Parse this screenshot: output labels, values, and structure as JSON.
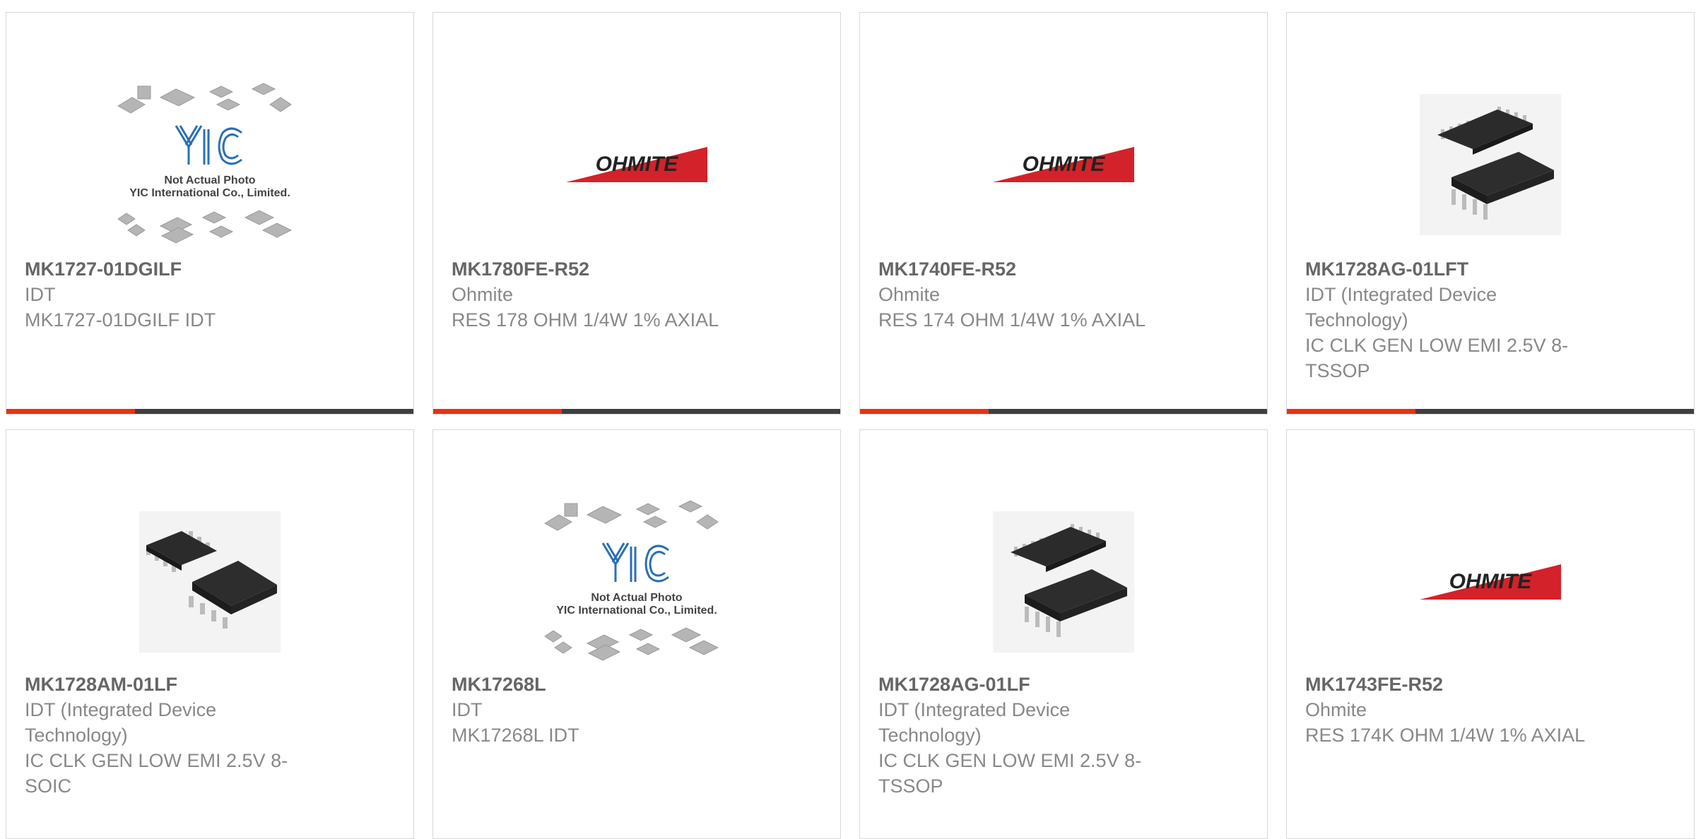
{
  "products": [
    {
      "part_number": "MK1727-01DGILF",
      "manufacturer": "IDT",
      "description": "MK1727-01DGILF IDT",
      "image": "yic-placeholder",
      "image_text_1": "Not Actual Photo",
      "image_text_2": "YIC International Co., Limited.",
      "image_logo": "YIC"
    },
    {
      "part_number": "MK1780FE-R52",
      "manufacturer": "Ohmite",
      "description": "RES 178 OHM 1/4W 1% AXIAL",
      "image": "ohmite-logo",
      "image_logo": "OHMITE"
    },
    {
      "part_number": "MK1740FE-R52",
      "manufacturer": "Ohmite",
      "description": "RES 174 OHM 1/4W 1% AXIAL",
      "image": "ohmite-logo",
      "image_logo": "OHMITE"
    },
    {
      "part_number": "MK1728AG-01LFT",
      "manufacturer": "IDT (Integrated Device Technology)",
      "description": "IC CLK GEN LOW EMI 2.5V 8-TSSOP",
      "image": "tssop-chip"
    },
    {
      "part_number": "MK1728AM-01LF",
      "manufacturer": "IDT (Integrated Device Technology)",
      "description": "IC CLK GEN LOW EMI 2.5V 8-SOIC",
      "image": "soic-chip"
    },
    {
      "part_number": "MK17268L",
      "manufacturer": "IDT",
      "description": "MK17268L IDT",
      "image": "yic-placeholder",
      "image_text_1": "Not Actual Photo",
      "image_text_2": "YIC International Co., Limited.",
      "image_logo": "YIC"
    },
    {
      "part_number": "MK1728AG-01LF",
      "manufacturer": "IDT (Integrated Device Technology)",
      "description": "IC CLK GEN LOW EMI 2.5V 8-TSSOP",
      "image": "tssop-chip"
    },
    {
      "part_number": "MK1743FE-R52",
      "manufacturer": "Ohmite",
      "description": "RES 174K OHM 1/4W 1% AXIAL",
      "image": "ohmite-logo",
      "image_logo": "OHMITE"
    }
  ],
  "colors": {
    "accent": "#e63312",
    "bar": "#3f3f3f",
    "ohmite_red": "#d3222a"
  }
}
